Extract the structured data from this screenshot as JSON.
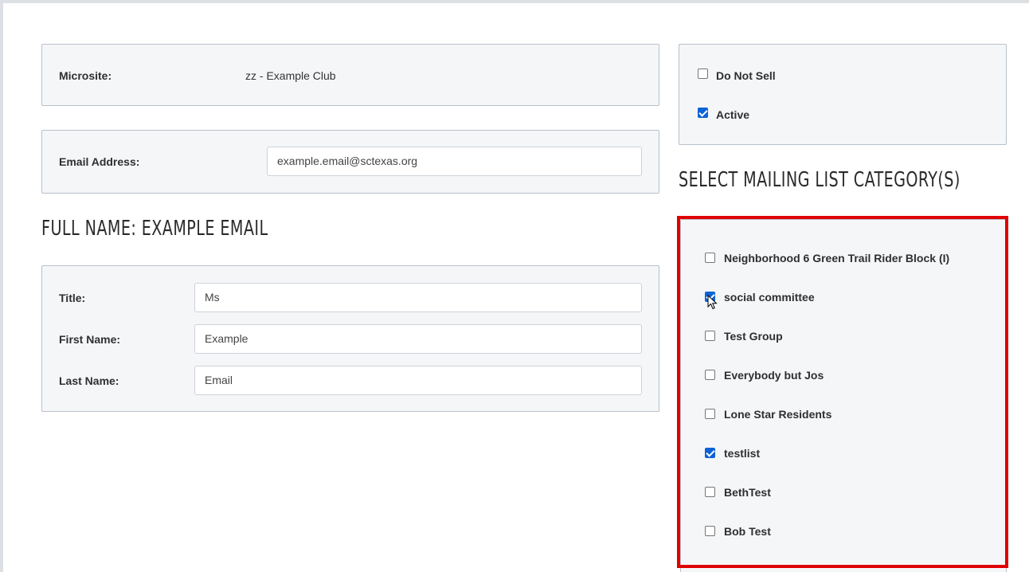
{
  "microsite": {
    "label": "Microsite:",
    "value": "zz - Example Club"
  },
  "email": {
    "label": "Email Address:",
    "value": "example.email@sctexas.org"
  },
  "full_name_heading": "FULL NAME: EXAMPLE EMAIL",
  "name_fields": {
    "title_label": "Title:",
    "title_value": "Ms",
    "first_label": "First Name:",
    "first_value": "Example",
    "last_label": "Last Name:",
    "last_value": "Email"
  },
  "flags": {
    "do_not_sell_label": "Do Not Sell",
    "do_not_sell_checked": false,
    "active_label": "Active",
    "active_checked": true
  },
  "mailing_heading": "SELECT MAILING LIST CATEGORY(S)",
  "mailing_lists": [
    {
      "label": "Neighborhood 6 Green Trail Rider Block (I)",
      "checked": false
    },
    {
      "label": "social committee",
      "checked": true
    },
    {
      "label": "Test Group",
      "checked": false
    },
    {
      "label": "Everybody but Jos",
      "checked": false
    },
    {
      "label": "Lone Star Residents",
      "checked": false
    },
    {
      "label": "testlist",
      "checked": true
    },
    {
      "label": "BethTest",
      "checked": false
    },
    {
      "label": "Bob Test",
      "checked": false
    }
  ],
  "colors": {
    "highlight_frame": "#e00000",
    "checkbox_checked": "#0b63d6"
  }
}
